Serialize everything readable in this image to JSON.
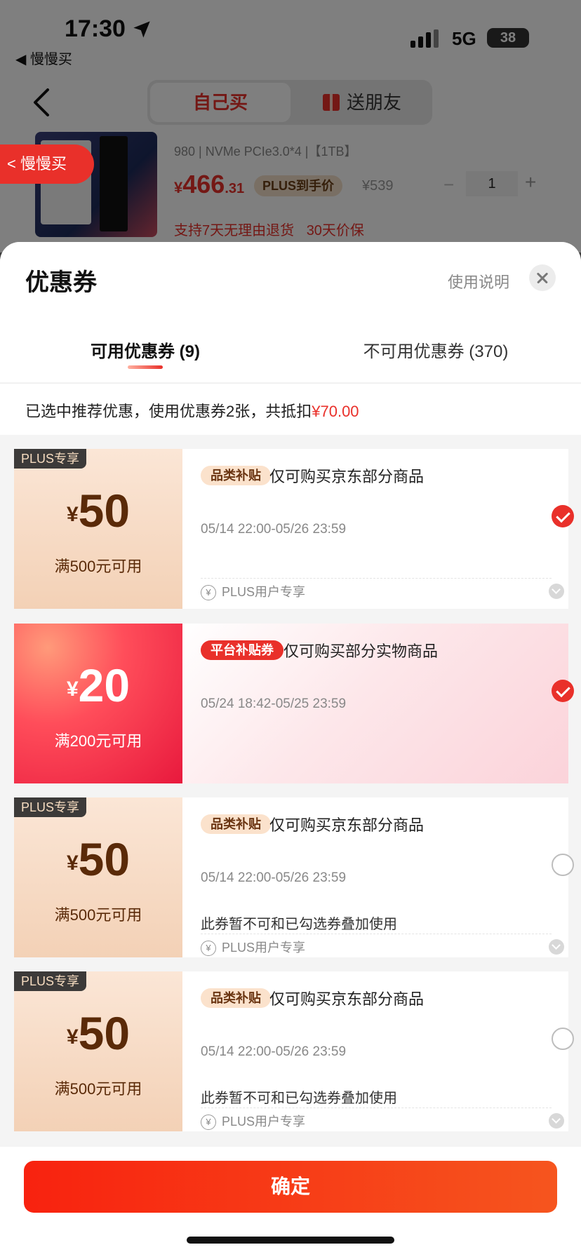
{
  "status_bar": {
    "time": "17:30",
    "back_app": "◀ 慢慢买",
    "network": "5G",
    "battery": "38"
  },
  "nav": {
    "tab_self": "自己买",
    "tab_gift": "送朋友",
    "float_back": "< 慢慢买"
  },
  "product": {
    "spec": "980 | NVMe PCIe3.0*4 |【1TB】",
    "price_symbol": "¥",
    "price_int": "466",
    "price_dec": ".31",
    "plus_label": "PLUS到手价",
    "original_price": "¥539",
    "qty_minus": "−",
    "quantity": "1",
    "qty_plus": "+",
    "guarantee_1": "支持7天无理由退货",
    "guarantee_2": "30天价保"
  },
  "sheet": {
    "title": "优惠券",
    "help": "使用说明",
    "tab_available": "可用优惠券 (9)",
    "tab_unavailable": "不可用优惠券 (370)",
    "summary_prefix": "已选中推荐优惠，使用优惠券2张，共抵扣",
    "summary_amount": "¥70.00"
  },
  "coupons": [
    {
      "tag": "PLUS专享",
      "symbol": "¥",
      "amount": "50",
      "threshold": "满500元可用",
      "category": "品类补贴",
      "scope": "仅可购买京东部分商品",
      "validity": "05/14 22:00-05/26 23:59",
      "note": "",
      "plus_only": "PLUS用户专享",
      "selected": true
    },
    {
      "tag": "",
      "symbol": "¥",
      "amount": "20",
      "threshold": "满200元可用",
      "category": "平台补贴券",
      "scope": "仅可购买部分实物商品",
      "validity": "05/24 18:42-05/25 23:59",
      "note": "",
      "plus_only": "",
      "selected": true
    },
    {
      "tag": "PLUS专享",
      "symbol": "¥",
      "amount": "50",
      "threshold": "满500元可用",
      "category": "品类补贴",
      "scope": "仅可购买京东部分商品",
      "validity": "05/14 22:00-05/26 23:59",
      "note": "此券暂不可和已勾选券叠加使用",
      "plus_only": "PLUS用户专享",
      "selected": false
    },
    {
      "tag": "PLUS专享",
      "symbol": "¥",
      "amount": "50",
      "threshold": "满500元可用",
      "category": "品类补贴",
      "scope": "仅可购买京东部分商品",
      "validity": "05/14 22:00-05/26 23:59",
      "note": "此券暂不可和已勾选券叠加使用",
      "plus_only": "PLUS用户专享",
      "selected": false
    }
  ],
  "footer": {
    "confirm": "确定"
  },
  "colors": {
    "accent": "#e9302a",
    "plus_dark": "#3c3a39",
    "coupon_gold": "#5a2a08"
  },
  "icons": [
    "location-arrow-icon",
    "signal-icon",
    "back-chevron-icon",
    "gift-icon",
    "close-icon",
    "yen-circle-icon",
    "expand-chevron-icon",
    "checkmark-icon",
    "radio-empty-icon"
  ]
}
